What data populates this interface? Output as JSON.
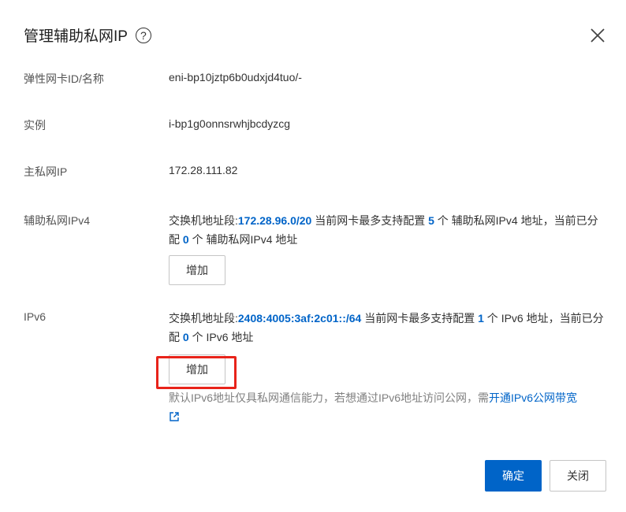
{
  "dialog": {
    "title": "管理辅助私网IP",
    "help_icon": "?",
    "close_icon": "close-icon"
  },
  "fields": {
    "eni_label": "弹性网卡ID/名称",
    "eni_value": "eni-bp10jztp6b0udxjd4tuo/-",
    "instance_label": "实例",
    "instance_value": "i-bp1g0onnsrwhjbcdyzcg",
    "primary_ip_label": "主私网IP",
    "primary_ip_value": "172.28.111.82"
  },
  "ipv4": {
    "label": "辅助私网IPv4",
    "switch_prefix": "交换机地址段:",
    "switch_cidr": "172.28.96.0/20",
    "text1": " 当前网卡最多支持配置 ",
    "max_count": "5",
    "text2": " 个 辅助私网IPv4 地址，当前已分配 ",
    "assigned_count": "0",
    "text3": " 个 辅助私网IPv4 地址",
    "add_button": "增加"
  },
  "ipv6": {
    "label": "IPv6",
    "switch_prefix": "交换机地址段:",
    "switch_cidr": "2408:4005:3af:2c01::/64",
    "text1": " 当前网卡最多支持配置 ",
    "max_count": "1",
    "text2": " 个 IPv6 地址，当前已分配 ",
    "assigned_count": "0",
    "text3": " 个 IPv6 地址",
    "add_button": "增加",
    "note_text": "默认IPv6地址仅具私网通信能力，若想通过IPv6地址访问公网，需",
    "note_link": "开通IPv6公网带宽"
  },
  "footer": {
    "confirm_label": "确定",
    "close_label": "关闭"
  },
  "colors": {
    "accent": "#0064c8",
    "highlight": "#e8231a"
  }
}
